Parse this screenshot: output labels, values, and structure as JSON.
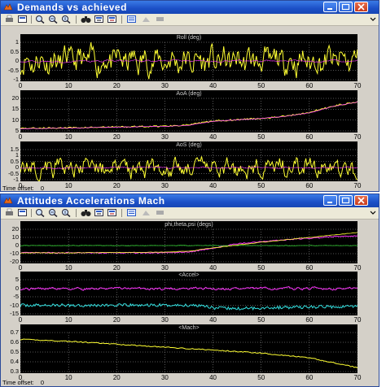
{
  "windows": [
    {
      "title": "Demands vs achieved",
      "time_offset_label": "Time offset:",
      "time_offset_value": "0"
    },
    {
      "title": "Attitudes Accelerations Mach",
      "time_offset_label": "Time offset:",
      "time_offset_value": "0"
    }
  ],
  "toolbar_icons": [
    "print-icon",
    "print-setup-icon",
    "zoom-icon",
    "zoom-x-icon",
    "zoom-y-icon",
    "binoculars-icon",
    "save-axes-icon",
    "restore-axes-icon",
    "params-icon",
    "float-icon",
    "dock-icon"
  ],
  "colors": {
    "title_bar": "#1b4fc6",
    "scope_background": "#000000",
    "yellow": "#ffff33",
    "magenta": "#ff33ff",
    "green": "#33cc33",
    "cyan": "#33e0e0",
    "grid": "#aaaaaa"
  },
  "x_axis": {
    "range": [
      0,
      70
    ],
    "ticks": [
      "0",
      "10",
      "20",
      "30",
      "40",
      "50",
      "60",
      "70"
    ]
  },
  "chart_data": [
    {
      "type": "line",
      "title": "Roll (deg)",
      "ylim": [
        -1,
        1
      ],
      "yticks": [
        "1",
        "0.5",
        "0",
        "-0.5",
        "-1"
      ],
      "xlim": [
        0,
        70
      ],
      "series": [
        {
          "color": "yellow",
          "shape": "noise about 0, amplitude ~0.6, peaks near ±1"
        },
        {
          "color": "magenta",
          "shape": "near 0, faint"
        }
      ]
    },
    {
      "type": "line",
      "title": "AoA (deg)",
      "ylim": [
        5,
        20
      ],
      "yticks": [
        "20",
        "15",
        "10",
        "5"
      ],
      "xlim": [
        0,
        70
      ],
      "series": [
        {
          "color": "yellow",
          "x": [
            0,
            10,
            20,
            30,
            35,
            40,
            45,
            50,
            55,
            60,
            65,
            70
          ],
          "y": [
            6.2,
            6.4,
            6.8,
            7.2,
            7.8,
            9.5,
            10.2,
            10.8,
            11.8,
            13.5,
            16.5,
            18.5
          ]
        },
        {
          "color": "magenta",
          "x": [
            0,
            10,
            20,
            30,
            35,
            40,
            45,
            50,
            55,
            60,
            65,
            70
          ],
          "y": [
            6.0,
            6.3,
            6.7,
            7.1,
            7.6,
            9.4,
            10.1,
            10.7,
            11.7,
            13.3,
            16.3,
            18.3
          ]
        }
      ]
    },
    {
      "type": "line",
      "title": "AoS (deg)",
      "ylim": [
        -1,
        1.5
      ],
      "yticks": [
        "1.5",
        "1",
        "0.5",
        "0",
        "-0.5",
        "-1"
      ],
      "xlim": [
        0,
        70
      ],
      "series": [
        {
          "color": "yellow",
          "shape": "noise about 0, amplitude ~0.7"
        },
        {
          "color": "magenta",
          "shape": "near 0, faint"
        }
      ]
    },
    {
      "type": "line",
      "title": "phi,theta,psi (degs)",
      "ylim": [
        -20,
        20
      ],
      "yticks": [
        "20",
        "10",
        "0",
        "-10",
        "-20"
      ],
      "xlim": [
        0,
        70
      ],
      "series": [
        {
          "color": "magenta",
          "x": [
            0,
            10,
            20,
            30,
            35,
            38,
            40,
            45,
            50,
            55,
            60,
            65,
            70
          ],
          "y": [
            -9,
            -9,
            -9,
            -9,
            -8,
            -5,
            -3,
            2,
            5,
            7,
            9,
            11,
            12
          ]
        },
        {
          "color": "green",
          "x": [
            0,
            35,
            40,
            70
          ],
          "y": [
            0,
            0,
            0,
            0
          ]
        },
        {
          "color": "yellow",
          "x": [
            0,
            10,
            20,
            30,
            35,
            40,
            50,
            60,
            70
          ],
          "y": [
            -9,
            -9,
            -8.5,
            -8,
            -7,
            -3,
            4,
            10,
            16
          ]
        }
      ]
    },
    {
      "type": "line",
      "title": "<Accel>",
      "ylim": [
        -15,
        5
      ],
      "yticks": [
        "5",
        "0",
        "-5",
        "-10",
        "-15"
      ],
      "xlim": [
        0,
        70
      ],
      "series": [
        {
          "color": "magenta",
          "shape": "about 0, small noise"
        },
        {
          "color": "cyan",
          "x": [
            0,
            10,
            20,
            30,
            38,
            40,
            45,
            50,
            60,
            70
          ],
          "y": [
            -10,
            -10,
            -10,
            -10,
            -10,
            -11.5,
            -12,
            -11.5,
            -11,
            -10.5
          ]
        }
      ]
    },
    {
      "type": "line",
      "title": "<Mach>",
      "ylim": [
        0.3,
        0.7
      ],
      "yticks": [
        "0.7",
        "0.6",
        "0.5",
        "0.4",
        "0.3"
      ],
      "xlim": [
        0,
        70
      ],
      "series": [
        {
          "color": "yellow",
          "x": [
            0,
            10,
            20,
            30,
            40,
            50,
            60,
            65,
            70
          ],
          "y": [
            0.63,
            0.61,
            0.58,
            0.55,
            0.52,
            0.49,
            0.44,
            0.39,
            0.34
          ]
        }
      ]
    }
  ]
}
